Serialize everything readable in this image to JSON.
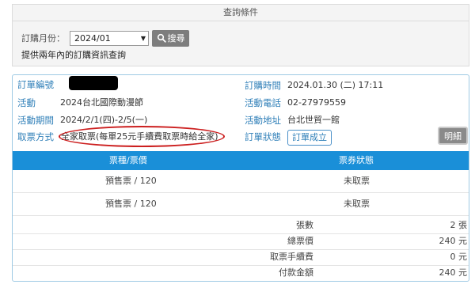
{
  "query": {
    "title": "查詢條件",
    "month_label": "訂購月份：",
    "month_value": "2024/01",
    "search_label": "搜尋",
    "note": "提供兩年內的訂購資訊查詢"
  },
  "order": {
    "left": [
      {
        "label": "訂單編號",
        "value": ""
      },
      {
        "label": "活動",
        "value": "2024台北國際動漫節"
      },
      {
        "label": "活動期間",
        "value": "2024/2/1(四)-2/5(一)"
      },
      {
        "label": "取票方式",
        "value": "全家取票(每單25元手續費取票時給全家)"
      }
    ],
    "right": [
      {
        "label": "訂購時間",
        "value": "2024.01.30 (二) 17:11"
      },
      {
        "label": "活動電話",
        "value": "02-27979559"
      },
      {
        "label": "活動地址",
        "value": "台北世貿一館"
      },
      {
        "label": "訂單狀態",
        "value": "訂單成立"
      }
    ],
    "detail_button": "明細",
    "table_headers": [
      "票種/票價",
      "票券狀態"
    ],
    "tickets": [
      {
        "type": "預售票 / 120",
        "status": "未取票"
      },
      {
        "type": "預售票 / 120",
        "status": "未取票"
      }
    ],
    "summary": [
      {
        "label": "張數",
        "value": "2 張"
      },
      {
        "label": "總票價",
        "value": "240 元"
      },
      {
        "label": "取票手續費",
        "value": "0 元"
      },
      {
        "label": "付款金額",
        "value": "240 元"
      }
    ]
  }
}
